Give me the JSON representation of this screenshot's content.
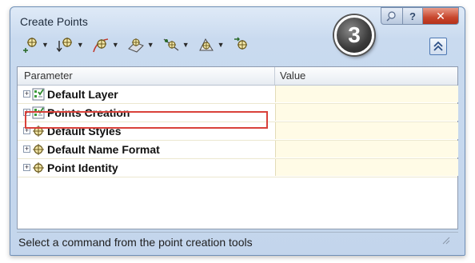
{
  "window": {
    "title": "Create Points",
    "controls": {
      "help_label": "?",
      "close_label": "✕",
      "pin_icon": "pin-icon"
    }
  },
  "toolbar": {
    "tools": [
      {
        "name": "point-tool-miscellaneous",
        "icon": "point-plus-icon",
        "has_dropdown": true
      },
      {
        "name": "point-tool-intersection",
        "icon": "point-arrow-icon",
        "has_dropdown": true
      },
      {
        "name": "point-tool-alignment",
        "icon": "point-alignment-icon",
        "has_dropdown": true
      },
      {
        "name": "point-tool-surface",
        "icon": "point-surface-icon",
        "has_dropdown": true
      },
      {
        "name": "point-tool-interpolate",
        "icon": "point-interpolate-icon",
        "has_dropdown": true
      },
      {
        "name": "point-tool-slope",
        "icon": "point-slope-icon",
        "has_dropdown": true
      },
      {
        "name": "point-tool-import",
        "icon": "point-import-icon",
        "has_dropdown": false
      }
    ],
    "step_badge": "3",
    "collapse_icon": "double-chevron-up-icon"
  },
  "grid": {
    "columns": {
      "parameter": "Parameter",
      "value": "Value"
    },
    "rows": [
      {
        "label": "Default Layer",
        "icon": "checklist-icon",
        "expanded": false,
        "highlighted": false
      },
      {
        "label": "Points Creation",
        "icon": "checklist-icon",
        "expanded": false,
        "highlighted": true
      },
      {
        "label": "Default Styles",
        "icon": "point-marker-icon",
        "expanded": false,
        "highlighted": false
      },
      {
        "label": "Default Name Format",
        "icon": "point-marker-icon",
        "expanded": false,
        "highlighted": false
      },
      {
        "label": "Point Identity",
        "icon": "point-marker-icon",
        "expanded": false,
        "highlighted": false
      }
    ]
  },
  "status": {
    "text": "Select a command from the point creation tools"
  },
  "colors": {
    "highlight": "#d9413a",
    "value_cell": "#fffbe6",
    "window_bg": "#c9daef"
  }
}
